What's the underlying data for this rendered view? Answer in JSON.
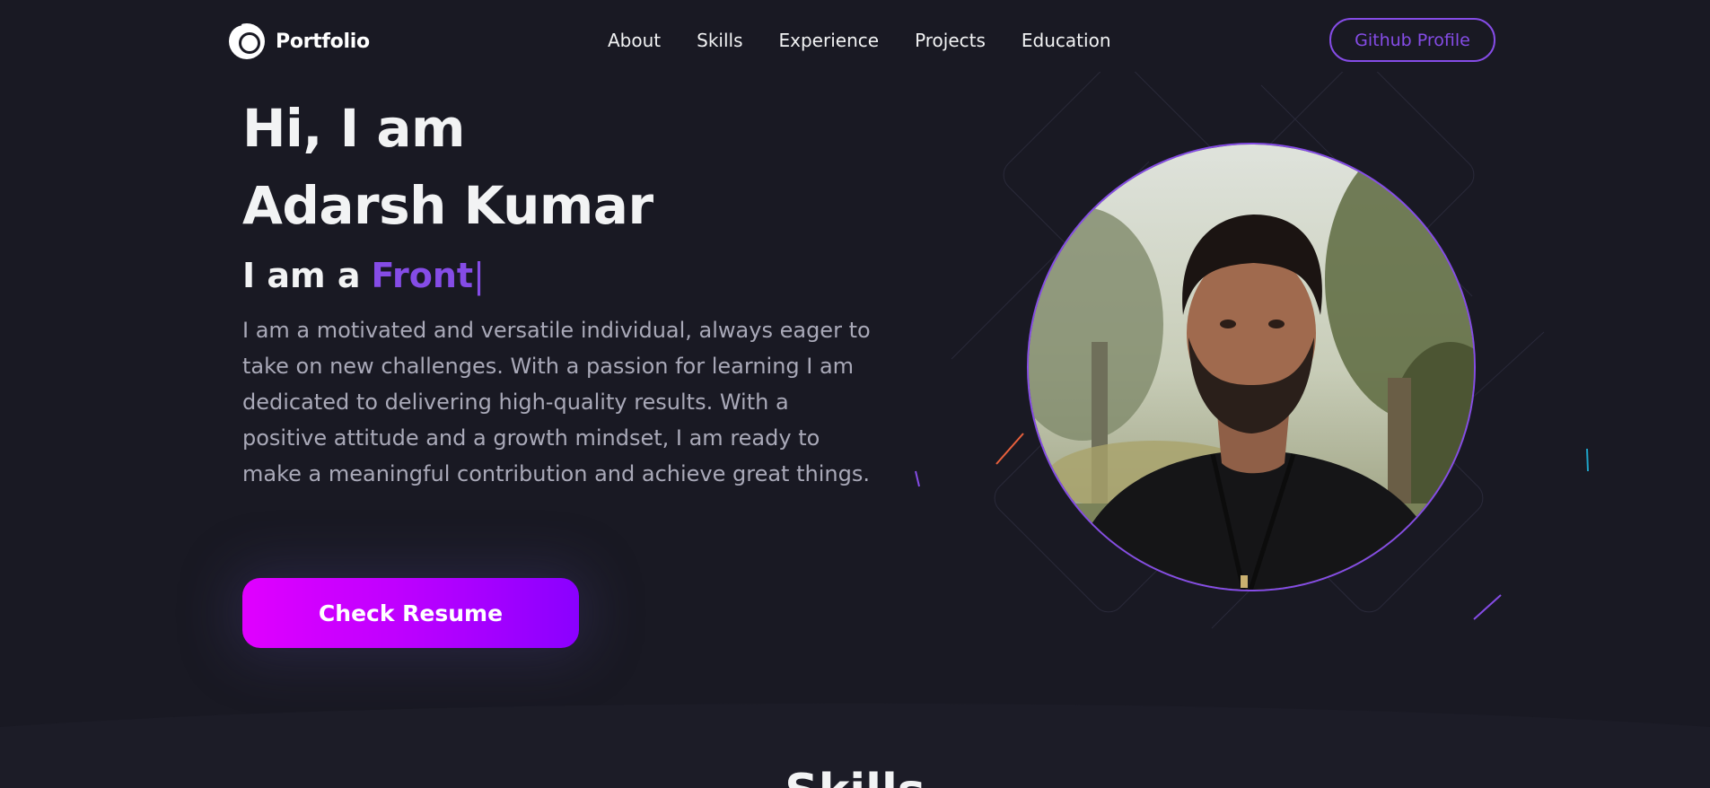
{
  "nav": {
    "logo_text": "Portfolio",
    "links": [
      {
        "label": "About"
      },
      {
        "label": "Skills"
      },
      {
        "label": "Experience"
      },
      {
        "label": "Projects"
      },
      {
        "label": "Education"
      }
    ],
    "github_label": "Github Profile"
  },
  "hero": {
    "title_line1": "Hi, I am",
    "title_line2": "Adarsh Kumar",
    "role_prefix": "I am a",
    "role_value": "Front",
    "role_cursor": "|",
    "bio": "I am a motivated and versatile individual, always eager to take on new challenges. With a passion for learning I am dedicated to delivering high-quality results. With a positive attitude and a growth mindset, I am ready to make a meaningful contribution and achieve great things.",
    "resume_label": "Check Resume"
  },
  "skills": {
    "title": "Skills"
  },
  "colors": {
    "background": "#191923",
    "accent": "#854ce6",
    "text_primary": "#f2f3f4",
    "text_secondary": "#a9a9b8",
    "button_gradient_start": "#e000ff",
    "button_gradient_end": "#8a00ff"
  },
  "icons": {
    "logo": "portfolio-logo-icon",
    "profile": "profile-photo"
  }
}
